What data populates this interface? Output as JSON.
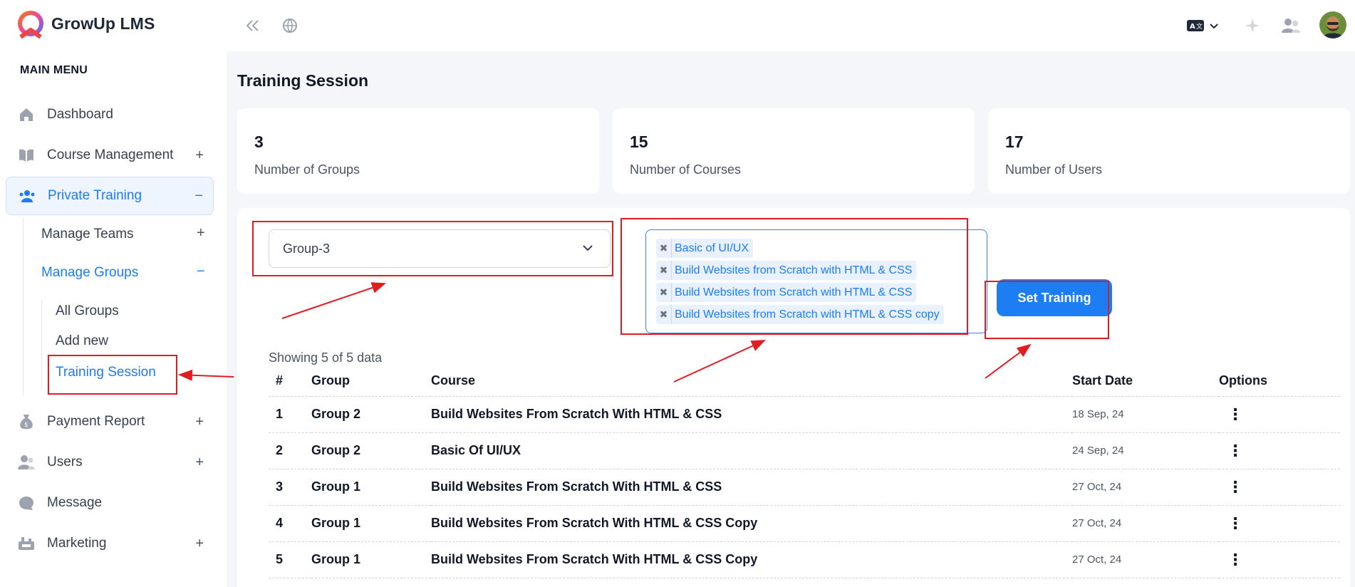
{
  "app": {
    "brand": "GrowUp LMS"
  },
  "sidebar": {
    "menu_title": "MAIN MENU",
    "items": [
      {
        "label": "Dashboard",
        "icon": "home-icon"
      },
      {
        "label": "Course Management",
        "icon": "book-icon",
        "toggle": "+"
      },
      {
        "label": "Private Training",
        "icon": "users-icon",
        "toggle": "−",
        "active": true
      },
      {
        "label": "Payment Report",
        "icon": "money-bag-icon",
        "toggle": "+"
      },
      {
        "label": "Users",
        "icon": "user-group-icon",
        "toggle": "+"
      },
      {
        "label": "Message",
        "icon": "chat-icon"
      },
      {
        "label": "Marketing",
        "icon": "megaphone-icon",
        "toggle": "+"
      }
    ],
    "private_training": {
      "manage_teams": {
        "label": "Manage Teams",
        "toggle": "+"
      },
      "manage_groups": {
        "label": "Manage Groups",
        "toggle": "−"
      },
      "groups_sub": [
        "All Groups",
        "Add new",
        "Training Session"
      ]
    }
  },
  "page": {
    "title": "Training Session",
    "stats": [
      {
        "value": "3",
        "label": "Number of Groups"
      },
      {
        "value": "15",
        "label": "Number of Courses"
      },
      {
        "value": "17",
        "label": "Number of Users"
      }
    ],
    "group_select": {
      "value": "Group-3"
    },
    "course_tags": [
      "Basic of UI/UX",
      "Build Websites from Scratch with HTML & CSS",
      "Build Websites from Scratch with HTML & CSS",
      "Build Websites from Scratch with HTML & CSS copy"
    ],
    "set_training_label": "Set Training",
    "showing": "Showing 5 of 5 data",
    "table": {
      "headers": [
        "#",
        "Group",
        "Course",
        "Start Date",
        "Options"
      ],
      "rows": [
        {
          "n": "1",
          "group": "Group 2",
          "course": "Build Websites From Scratch With HTML & CSS",
          "date": "18 Sep, 24"
        },
        {
          "n": "2",
          "group": "Group 2",
          "course": "Basic Of UI/UX",
          "date": "24 Sep, 24"
        },
        {
          "n": "3",
          "group": "Group 1",
          "course": "Build Websites From Scratch With HTML & CSS",
          "date": "27 Oct, 24"
        },
        {
          "n": "4",
          "group": "Group 1",
          "course": "Build Websites From Scratch With HTML & CSS Copy",
          "date": "27 Oct, 24"
        },
        {
          "n": "5",
          "group": "Group 1",
          "course": "Build Websites From Scratch With HTML & CSS Copy",
          "date": "27 Oct, 24"
        }
      ]
    }
  },
  "colors": {
    "accent": "#1d7df2",
    "annotation": "#e11d24"
  }
}
